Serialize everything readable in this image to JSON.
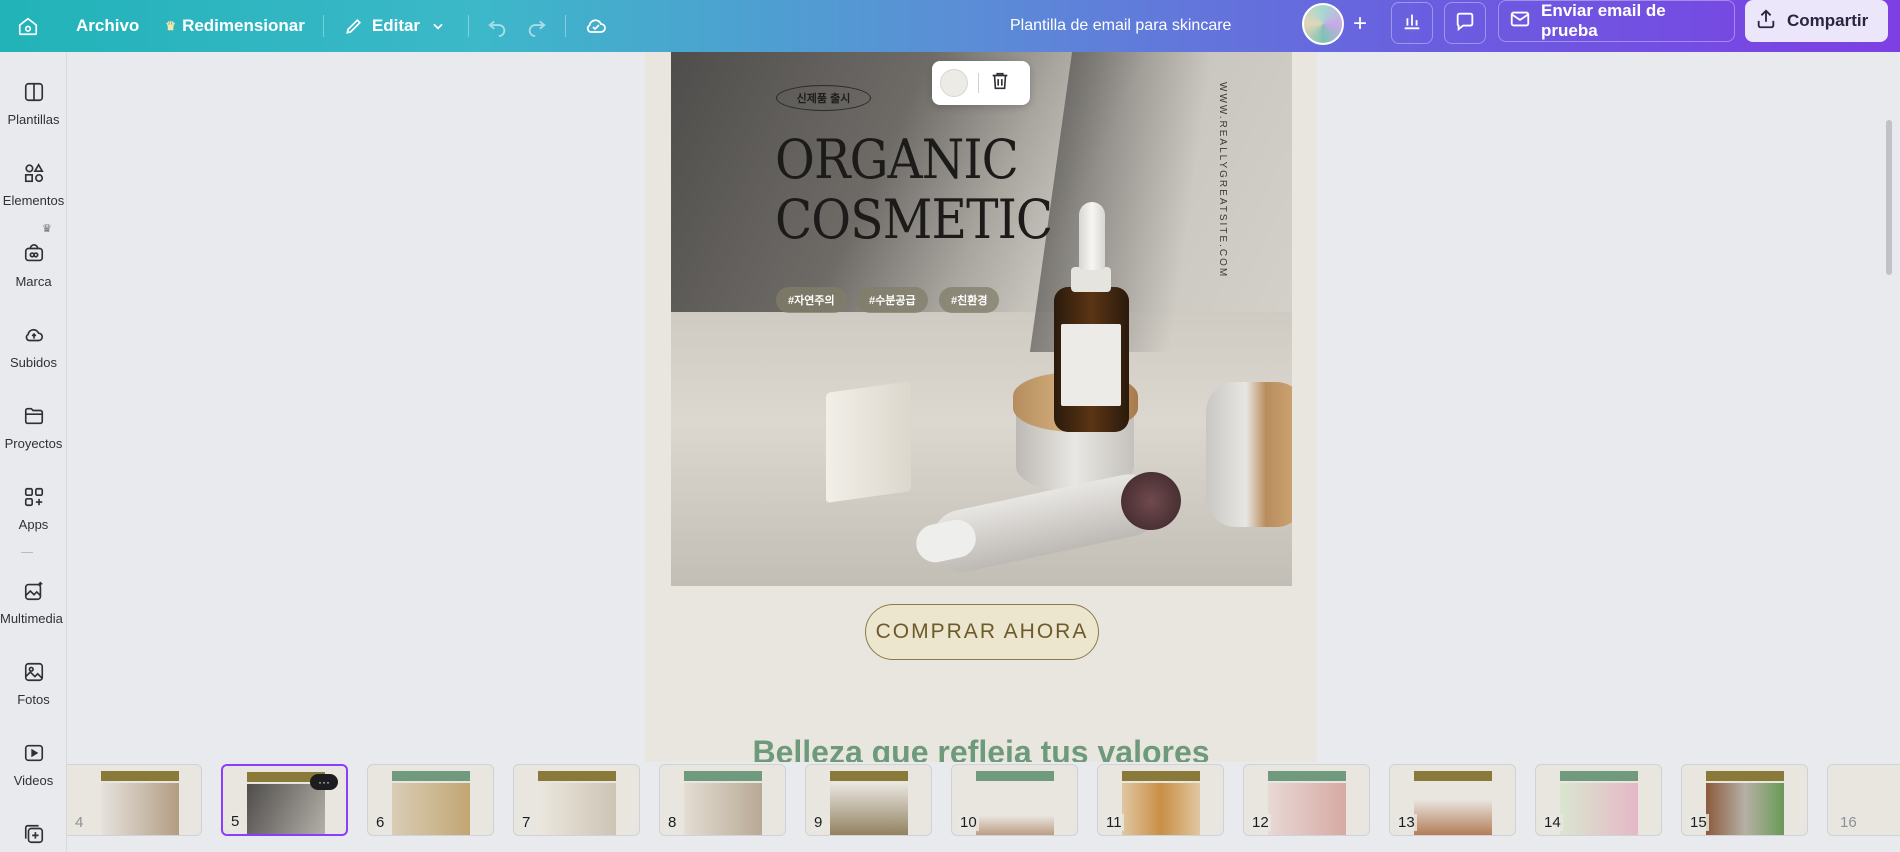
{
  "topbar": {
    "home_icon": "home-icon",
    "file_label": "Archivo",
    "resize_label": "Redimensionar",
    "edit_label": "Editar",
    "doc_title": "Plantilla de email para skincare",
    "email_test_label": "Enviar email de prueba",
    "share_label": "Compartir"
  },
  "rail": {
    "items": [
      {
        "label": "Plantillas",
        "icon": "templates-icon"
      },
      {
        "label": "Elementos",
        "icon": "elements-icon"
      },
      {
        "label": "Marca",
        "icon": "brand-icon"
      },
      {
        "label": "Subidos",
        "icon": "upload-icon"
      },
      {
        "label": "Proyectos",
        "icon": "folder-icon"
      },
      {
        "label": "Apps",
        "icon": "apps-icon"
      },
      {
        "label": "Multimedia ...",
        "icon": "magic-media-icon"
      },
      {
        "label": "Fotos",
        "icon": "photo-icon"
      },
      {
        "label": "Videos",
        "icon": "video-icon"
      }
    ]
  },
  "design": {
    "badge": "신제품 출시",
    "title_line1": "ORGANIC",
    "title_line2": "COSMETIC",
    "hashtags": [
      "#자연주의",
      "#수분공급",
      "#친환경"
    ],
    "site": "WWW.REALLYGREATSITE.COM",
    "cta": "COMPRAR AHORA",
    "section_title": "Belleza que refleja tus valores"
  },
  "colors": {
    "accent": "#8b3dff",
    "cta_text": "#6c5a2a",
    "section_green": "#6d9a7a",
    "thumb_olive": "#8a7a3a",
    "thumb_green": "#6f9a7e"
  },
  "filmstrip": {
    "pages": [
      "4",
      "5",
      "6",
      "7",
      "8",
      "9",
      "10",
      "11",
      "12",
      "13",
      "14",
      "15",
      "16"
    ],
    "active_page": "5",
    "more_label": "···"
  }
}
